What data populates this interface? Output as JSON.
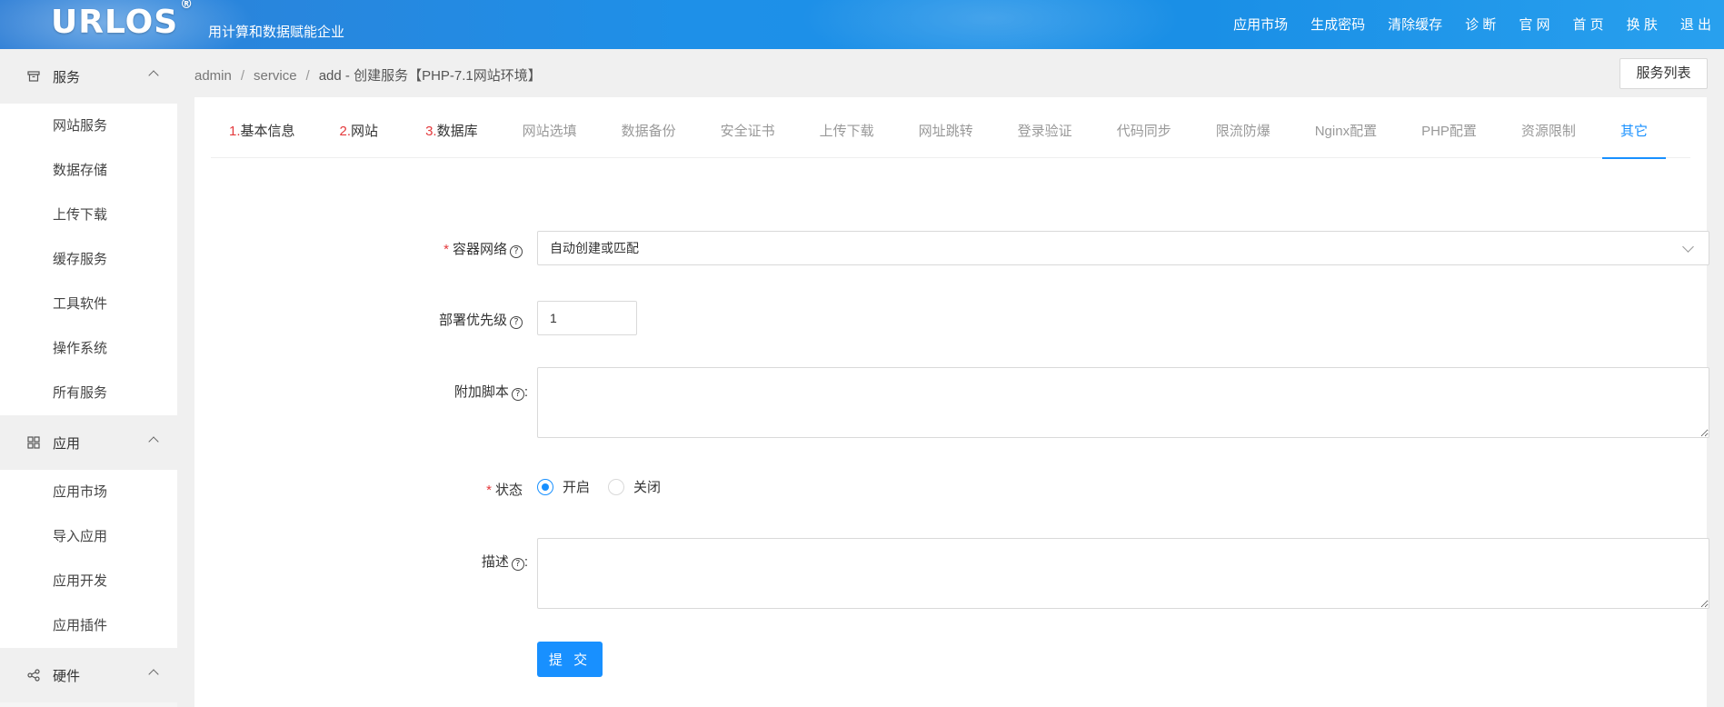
{
  "header": {
    "logo": "URLOS",
    "logo_mark": "®",
    "slogan": "用计算和数据赋能企业",
    "nav": [
      "应用市场",
      "生成密码",
      "清除缓存",
      "诊 断",
      "官 网",
      "首 页",
      "换 肤",
      "退 出"
    ]
  },
  "sidebar": {
    "groups": [
      {
        "label": "服务",
        "icon": "box-icon",
        "items": [
          "网站服务",
          "数据存储",
          "上传下载",
          "缓存服务",
          "工具软件",
          "操作系统",
          "所有服务"
        ]
      },
      {
        "label": "应用",
        "icon": "grid-icon",
        "items": [
          "应用市场",
          "导入应用",
          "应用开发",
          "应用插件"
        ]
      },
      {
        "label": "硬件",
        "icon": "share-icon",
        "items": []
      }
    ]
  },
  "breadcrumb": {
    "items": [
      "admin",
      "service"
    ],
    "current": "add  -  创建服务【PHP-7.1网站环境】"
  },
  "list_button": "服务列表",
  "tabs": [
    {
      "num": "1.",
      "label": "基本信息"
    },
    {
      "num": "2.",
      "label": "网站"
    },
    {
      "num": "3.",
      "label": "数据库"
    },
    {
      "num": "",
      "label": "网站选填"
    },
    {
      "num": "",
      "label": "数据备份"
    },
    {
      "num": "",
      "label": "安全证书"
    },
    {
      "num": "",
      "label": "上传下载"
    },
    {
      "num": "",
      "label": "网址跳转"
    },
    {
      "num": "",
      "label": "登录验证"
    },
    {
      "num": "",
      "label": "代码同步"
    },
    {
      "num": "",
      "label": "限流防爆"
    },
    {
      "num": "",
      "label": "Nginx配置"
    },
    {
      "num": "",
      "label": "PHP配置"
    },
    {
      "num": "",
      "label": "资源限制"
    },
    {
      "num": "",
      "label": "其它"
    }
  ],
  "form": {
    "network": {
      "label": "容器网络",
      "value": "自动创建或匹配"
    },
    "priority": {
      "label": "部署优先级",
      "value": "1"
    },
    "script": {
      "label": "附加脚本",
      "suffix": ":"
    },
    "status": {
      "label": "状态",
      "options": [
        "开启",
        "关闭"
      ],
      "selected": "开启"
    },
    "desc": {
      "label": "描述",
      "suffix": ":"
    },
    "submit": "提 交"
  }
}
